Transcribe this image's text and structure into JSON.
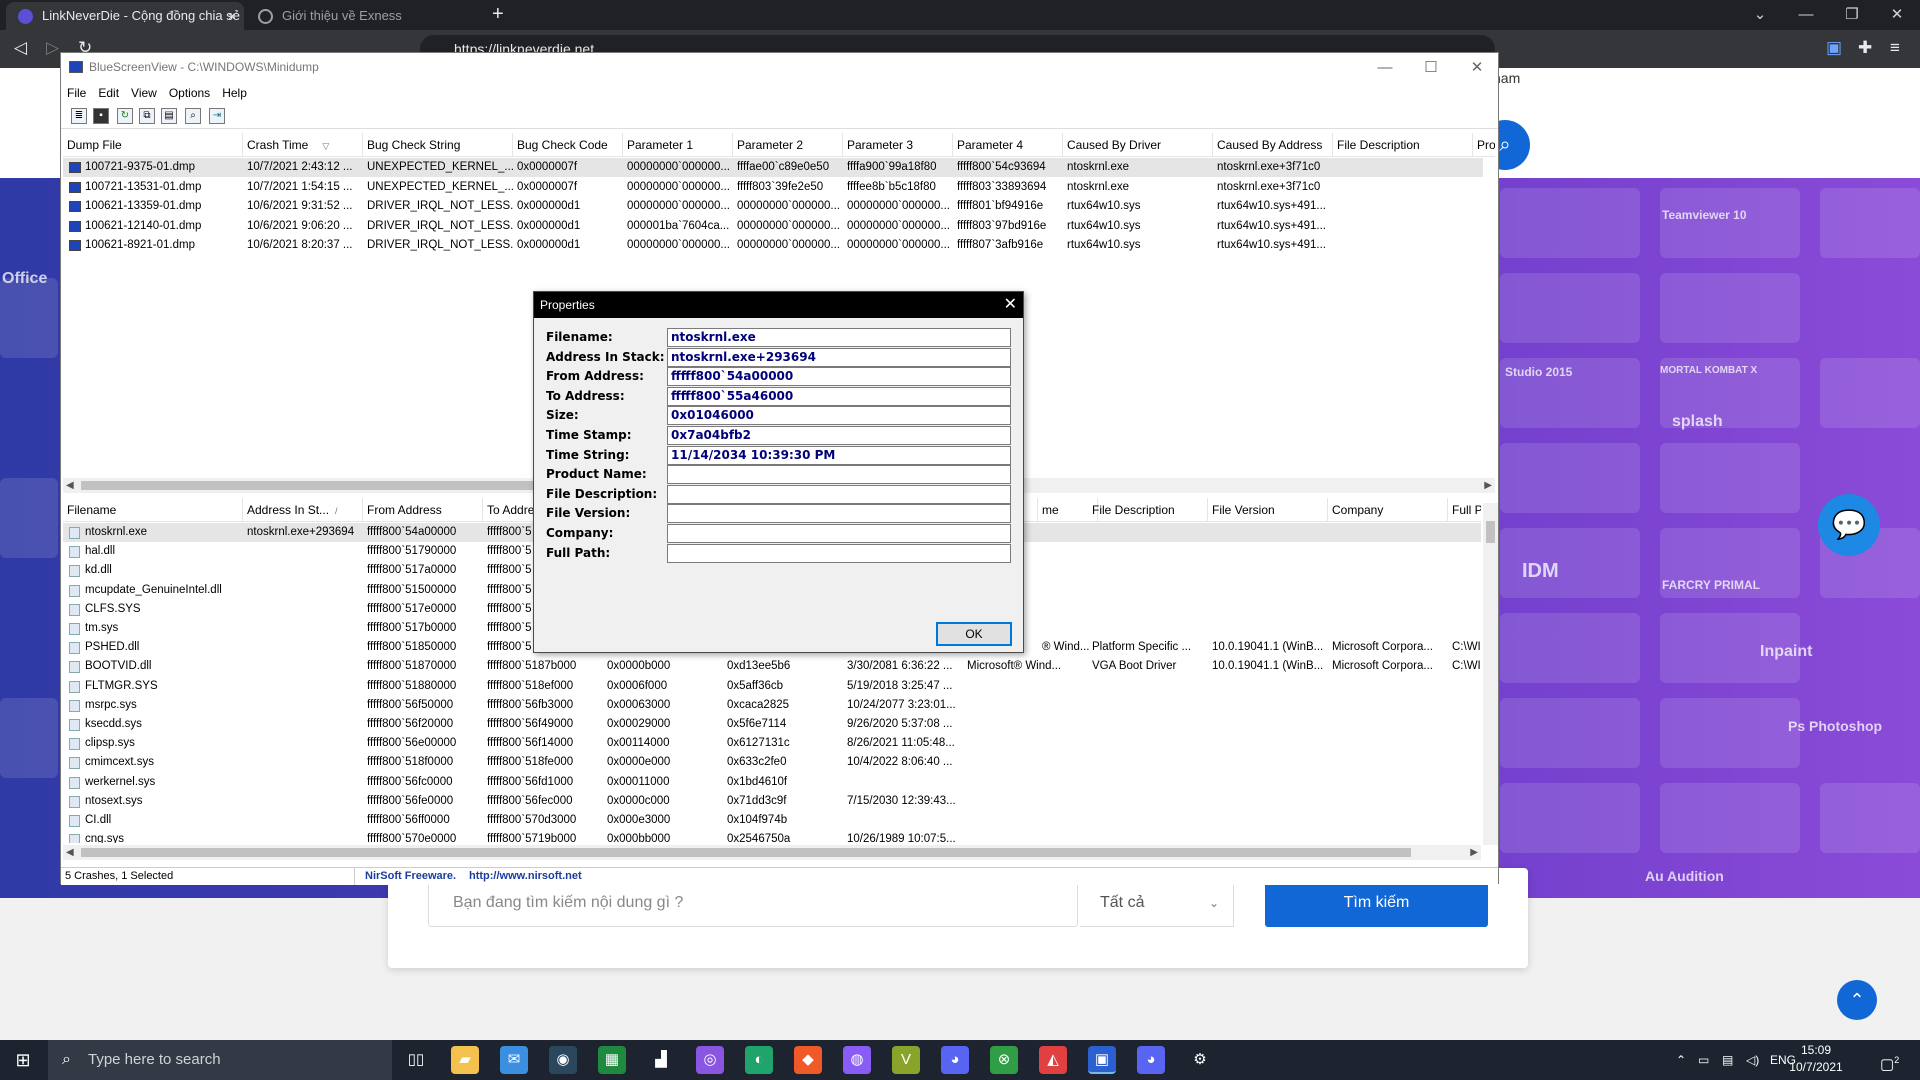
{
  "browser": {
    "tabs": [
      {
        "title": "LinkNeverDie - Cộng đồng chia sẻ",
        "close": "×"
      },
      {
        "title": "Giới thiệu về Exness"
      }
    ],
    "new_tab": "+",
    "url": "https://linkneverdie.net",
    "window_controls": [
      "⌄",
      "—",
      "❐",
      "✕"
    ]
  },
  "site": {
    "header_text": "nam",
    "search_placeholder": "Bạn đang tìm kiếm nội dung gì ?",
    "search_select": "Tất cả",
    "search_button": "Tìm kiếm",
    "banner_labels": [
      "Office",
      "Teamviewer 10",
      "splash",
      "IDM",
      "FARCRY PRIMAL",
      "Inpaint",
      "Ps Photoshop",
      "Au Audition",
      "Studio 2015",
      "MORTAL KOMBAT X"
    ]
  },
  "bsv": {
    "title": "BlueScreenView - C:\\WINDOWS\\Minidump",
    "menu": [
      "File",
      "Edit",
      "View",
      "Options",
      "Help"
    ],
    "crash_columns": [
      "Dump File",
      "Crash Time",
      "Bug Check String",
      "Bug Check Code",
      "Parameter 1",
      "Parameter 2",
      "Parameter 3",
      "Parameter 4",
      "Caused By Driver",
      "Caused By Address",
      "File Description",
      "Pro"
    ],
    "crashes": [
      [
        "100721-9375-01.dmp",
        "10/7/2021 2:43:12 ...",
        "UNEXPECTED_KERNEL_...",
        "0x0000007f",
        "00000000`000000...",
        "ffffae00`c89e0e50",
        "ffffa900`99a18f80",
        "fffff800`54c93694",
        "ntoskrnl.exe",
        "ntoskrnl.exe+3f71c0",
        "",
        ""
      ],
      [
        "100721-13531-01.dmp",
        "10/7/2021 1:54:15 ...",
        "UNEXPECTED_KERNEL_...",
        "0x0000007f",
        "00000000`000000...",
        "fffff803`39fe2e50",
        "ffffee8b`b5c18f80",
        "fffff803`33893694",
        "ntoskrnl.exe",
        "ntoskrnl.exe+3f71c0",
        "",
        ""
      ],
      [
        "100621-13359-01.dmp",
        "10/6/2021 9:31:52 ...",
        "DRIVER_IRQL_NOT_LESS...",
        "0x000000d1",
        "00000000`000000...",
        "00000000`000000...",
        "00000000`000000...",
        "fffff801`bf94916e",
        "rtux64w10.sys",
        "rtux64w10.sys+491...",
        "",
        ""
      ],
      [
        "100621-12140-01.dmp",
        "10/6/2021 9:06:20 ...",
        "DRIVER_IRQL_NOT_LESS...",
        "0x000000d1",
        "000001ba`7604ca...",
        "00000000`000000...",
        "00000000`000000...",
        "fffff803`97bd916e",
        "rtux64w10.sys",
        "rtux64w10.sys+491...",
        "",
        ""
      ],
      [
        "100621-8921-01.dmp",
        "10/6/2021 8:20:37 ...",
        "DRIVER_IRQL_NOT_LESS...",
        "0x000000d1",
        "00000000`000000...",
        "00000000`000000...",
        "00000000`000000...",
        "fffff807`3afb916e",
        "rtux64w10.sys",
        "rtux64w10.sys+491...",
        "",
        ""
      ]
    ],
    "selected_crash": 0,
    "driver_columns": [
      "Filename",
      "Address In St...",
      "From Address",
      "To Addre",
      "",
      "",
      "",
      "",
      "me",
      "File Description",
      "File Version",
      "Company",
      "Full Pa"
    ],
    "drivers": [
      [
        "ntoskrnl.exe",
        "ntoskrnl.exe+293694",
        "fffff800`54a00000",
        "fffff800`5",
        "",
        "",
        "",
        "",
        "",
        "",
        "",
        "",
        ""
      ],
      [
        "hal.dll",
        "",
        "fffff800`51790000",
        "fffff800`5",
        "",
        "",
        "",
        "",
        "",
        "",
        "",
        "",
        ""
      ],
      [
        "kd.dll",
        "",
        "fffff800`517a0000",
        "fffff800`5",
        "",
        "",
        "",
        "",
        "",
        "",
        "",
        "",
        ""
      ],
      [
        "mcupdate_GenuineIntel.dll",
        "",
        "fffff800`51500000",
        "fffff800`5",
        "",
        "",
        "",
        "",
        "",
        "",
        "",
        "",
        ""
      ],
      [
        "CLFS.SYS",
        "",
        "fffff800`517e0000",
        "fffff800`5",
        "",
        "",
        "",
        "",
        "",
        "",
        "",
        "",
        ""
      ],
      [
        "tm.sys",
        "",
        "fffff800`517b0000",
        "fffff800`5",
        "",
        "",
        "",
        "",
        "",
        "",
        "",
        "",
        ""
      ],
      [
        "PSHED.dll",
        "",
        "fffff800`51850000",
        "fffff800`5",
        "",
        "",
        "",
        "",
        "® Wind...",
        "Platform Specific ...",
        "10.0.19041.1 (WinB...",
        "Microsoft Corpora...",
        "C:\\WIN"
      ],
      [
        "BOOTVID.dll",
        "",
        "fffff800`51870000",
        "fffff800`5187b000",
        "0x0000b000",
        "0xd13ee5b6",
        "3/30/2081 6:36:22 ...",
        "Microsoft® Wind...",
        "",
        "VGA Boot Driver",
        "10.0.19041.1 (WinB...",
        "Microsoft Corpora...",
        "C:\\WIN"
      ],
      [
        "FLTMGR.SYS",
        "",
        "fffff800`51880000",
        "fffff800`518ef000",
        "0x0006f000",
        "0x5aff36cb",
        "5/19/2018 3:25:47 ...",
        "",
        "",
        "",
        "",
        "",
        ""
      ],
      [
        "msrpc.sys",
        "",
        "fffff800`56f50000",
        "fffff800`56fb3000",
        "0x00063000",
        "0xcaca2825",
        "10/24/2077 3:23:01...",
        "",
        "",
        "",
        "",
        "",
        ""
      ],
      [
        "ksecdd.sys",
        "",
        "fffff800`56f20000",
        "fffff800`56f49000",
        "0x00029000",
        "0x5f6e7114",
        "9/26/2020 5:37:08 ...",
        "",
        "",
        "",
        "",
        "",
        ""
      ],
      [
        "clipsp.sys",
        "",
        "fffff800`56e00000",
        "fffff800`56f14000",
        "0x00114000",
        "0x6127131c",
        "8/26/2021 11:05:48...",
        "",
        "",
        "",
        "",
        "",
        ""
      ],
      [
        "cmimcext.sys",
        "",
        "fffff800`518f0000",
        "fffff800`518fe000",
        "0x0000e000",
        "0x633c2fe0",
        "10/4/2022 8:06:40 ...",
        "",
        "",
        "",
        "",
        "",
        ""
      ],
      [
        "werkernel.sys",
        "",
        "fffff800`56fc0000",
        "fffff800`56fd1000",
        "0x00011000",
        "0x1bd4610f",
        "",
        "",
        "",
        "",
        "",
        "",
        ""
      ],
      [
        "ntosext.sys",
        "",
        "fffff800`56fe0000",
        "fffff800`56fec000",
        "0x0000c000",
        "0x71dd3c9f",
        "7/15/2030 12:39:43...",
        "",
        "",
        "",
        "",
        "",
        ""
      ],
      [
        "CI.dll",
        "",
        "fffff800`56ff0000",
        "fffff800`570d3000",
        "0x000e3000",
        "0x104f974b",
        "",
        "",
        "",
        "",
        "",
        "",
        ""
      ],
      [
        "cng.sys",
        "",
        "fffff800`570e0000",
        "fffff800`5719b000",
        "0x000bb000",
        "0x2546750a",
        "10/26/1989 10:07:5...",
        "",
        "",
        "",
        "",
        "",
        ""
      ]
    ],
    "status": {
      "left": "5 Crashes, 1 Selected",
      "vendor": "NirSoft Freeware.",
      "link": "http://www.nirsoft.net"
    }
  },
  "properties": {
    "title": "Properties",
    "close": "✕",
    "fields": [
      {
        "label": "Filename:",
        "value": "ntoskrnl.exe"
      },
      {
        "label": "Address In Stack:",
        "value": "ntoskrnl.exe+293694"
      },
      {
        "label": "From Address:",
        "value": "fffff800`54a00000"
      },
      {
        "label": "To Address:",
        "value": "fffff800`55a46000"
      },
      {
        "label": "Size:",
        "value": "0x01046000"
      },
      {
        "label": "Time Stamp:",
        "value": "0x7a04bfb2"
      },
      {
        "label": "Time String:",
        "value": "11/14/2034 10:39:30 PM"
      },
      {
        "label": "Product Name:",
        "value": ""
      },
      {
        "label": "File Description:",
        "value": ""
      },
      {
        "label": "File Version:",
        "value": ""
      },
      {
        "label": "Company:",
        "value": ""
      },
      {
        "label": "Full Path:",
        "value": ""
      }
    ],
    "ok": "OK"
  },
  "taskbar": {
    "search_placeholder": "Type here to search",
    "apps": [
      "task-view",
      "file-explorer",
      "mail",
      "steam",
      "excel-like",
      "app",
      "gamepad",
      "edge",
      "brave",
      "messenger",
      "vectorworks",
      "discord",
      "xbox",
      "game-launcher",
      "bluescreenview",
      "discord-alt",
      "settings"
    ],
    "language": "ENG",
    "time": "15:09",
    "date": "10/7/2021",
    "notifications": "2"
  }
}
